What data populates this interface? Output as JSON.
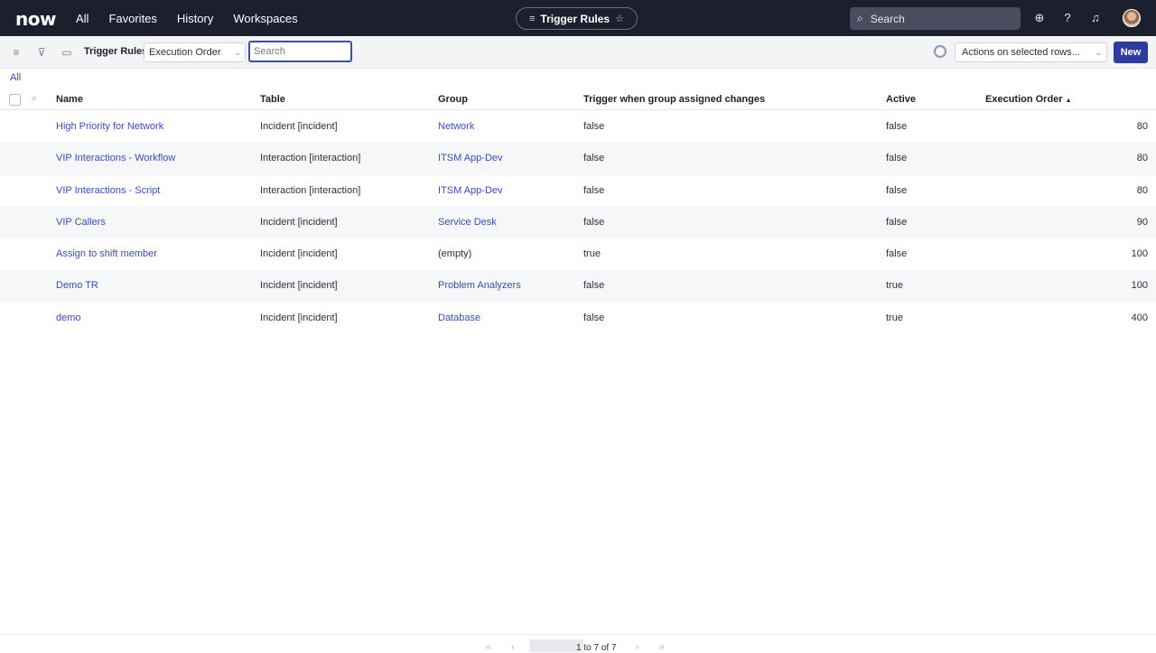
{
  "topbar": {
    "logo": "now",
    "nav": [
      "All",
      "Favorites",
      "History",
      "Workspaces"
    ],
    "center_title": "Trigger Rules",
    "search_placeholder": "Search"
  },
  "toolbar": {
    "title": "Trigger Rules",
    "field_select": "Execution Order",
    "search_placeholder": "Search",
    "actions_select": "Actions on selected rows...",
    "new_button": "New"
  },
  "breadcrumb": "All",
  "columns": [
    "Name",
    "Table",
    "Group",
    "Trigger when group assigned changes",
    "Active",
    "Execution Order"
  ],
  "sort_indicator": "▲",
  "rows": [
    {
      "name": "High Priority for Network",
      "table": "Incident [incident]",
      "group": "Network",
      "trigger": "false",
      "active": "false",
      "order": "80"
    },
    {
      "name": "VIP Interactions - Workflow",
      "table": "Interaction [interaction]",
      "group": "ITSM App-Dev",
      "trigger": "false",
      "active": "false",
      "order": "80"
    },
    {
      "name": "VIP Interactions - Script",
      "table": "Interaction [interaction]",
      "group": "ITSM App-Dev",
      "trigger": "false",
      "active": "false",
      "order": "80"
    },
    {
      "name": "VIP Callers",
      "table": "Incident [incident]",
      "group": "Service Desk",
      "trigger": "false",
      "active": "false",
      "order": "90"
    },
    {
      "name": "Assign to shift member",
      "table": "Incident [incident]",
      "group": "(empty)",
      "trigger": "true",
      "active": "false",
      "order": "100"
    },
    {
      "name": "Demo TR",
      "table": "Incident [incident]",
      "group": "Problem Analyzers",
      "trigger": "false",
      "active": "true",
      "order": "100"
    },
    {
      "name": "demo",
      "table": "Incident [incident]",
      "group": "Database",
      "trigger": "false",
      "active": "true",
      "order": "400"
    }
  ],
  "pagination": {
    "text": "1 to 7 of 7"
  }
}
